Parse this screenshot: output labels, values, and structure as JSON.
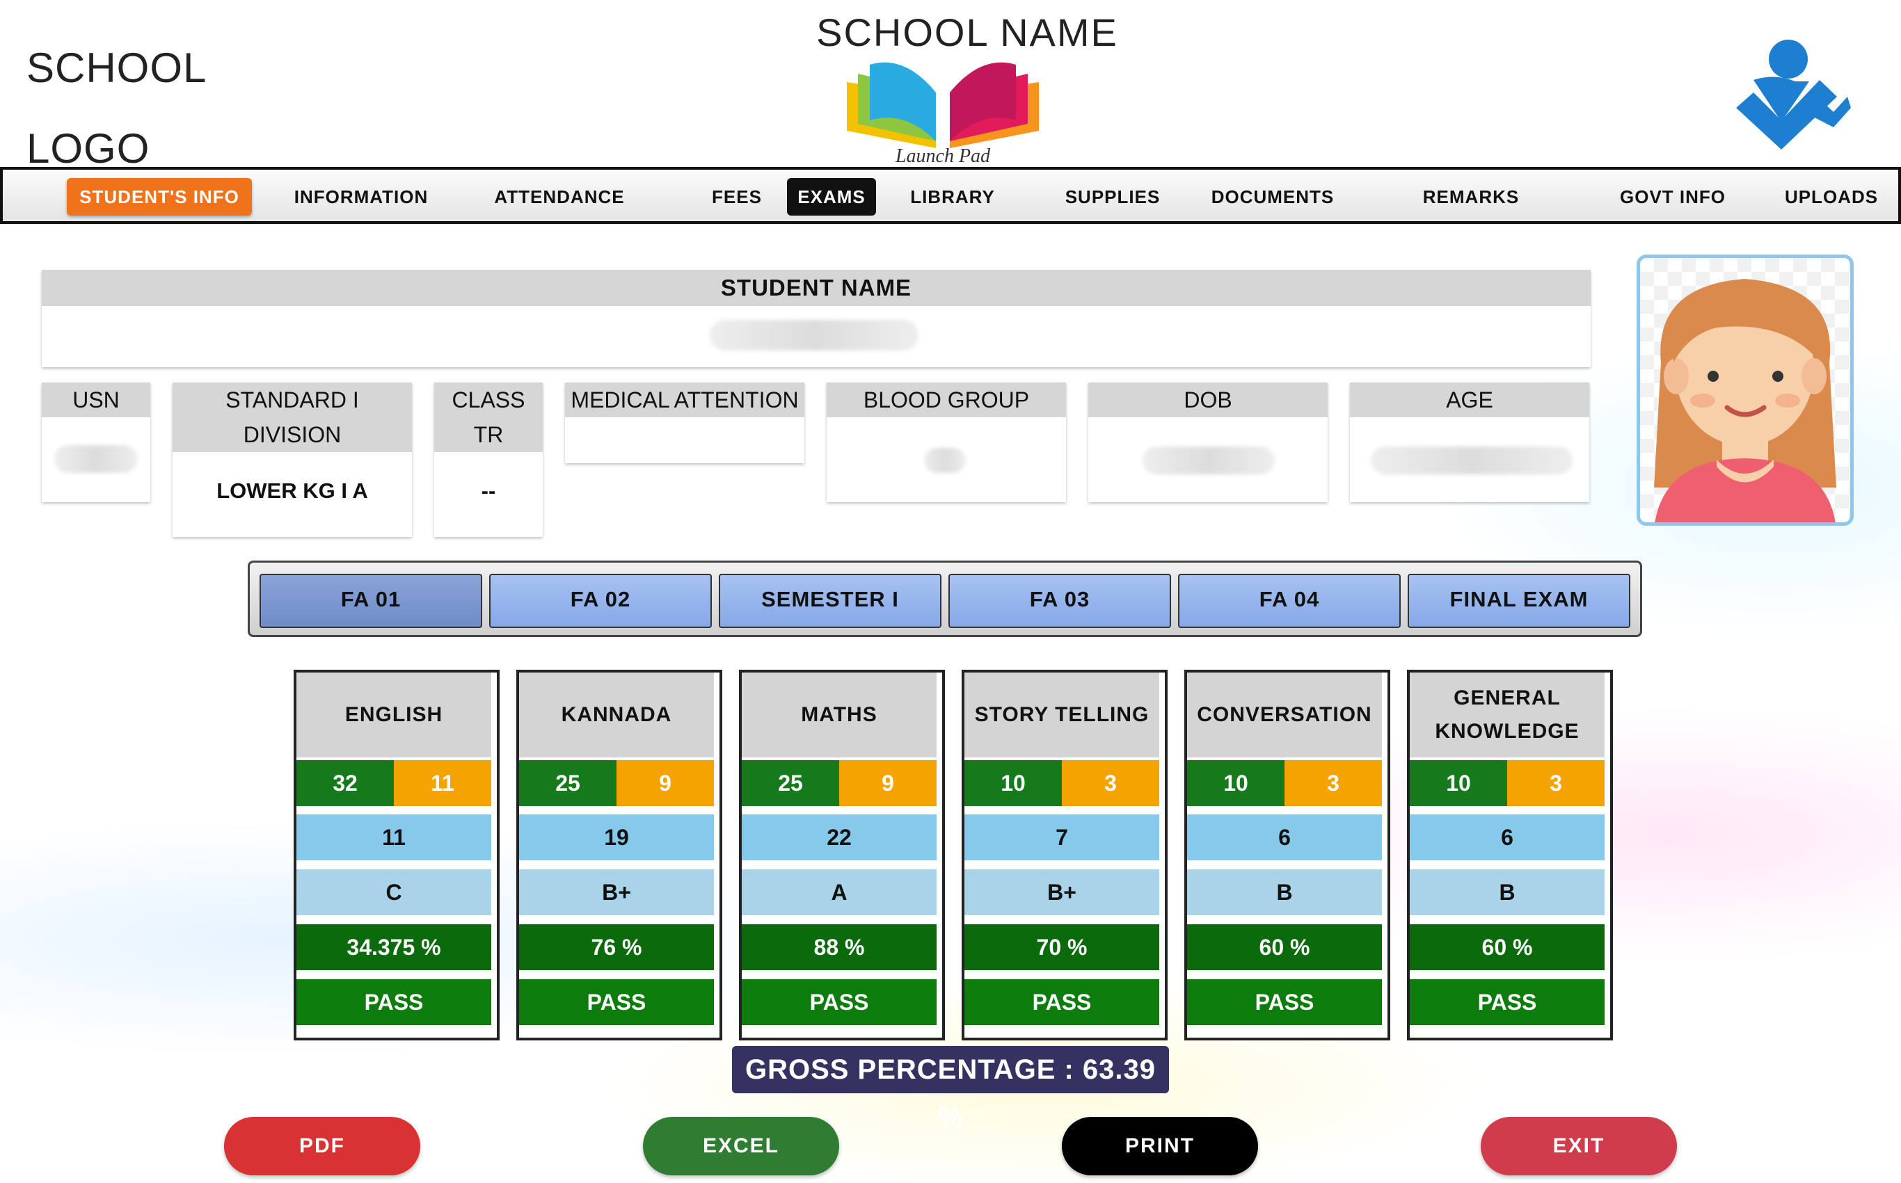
{
  "header": {
    "school_logo_line1": "SCHOOL",
    "school_logo_line2": "LOGO",
    "school_name": "SCHOOL NAME",
    "logo_caption": "Launch Pad",
    "brand_icon": "person-check-icon"
  },
  "nav": {
    "items": [
      "STUDENT'S INFO",
      "INFORMATION",
      "ATTENDANCE",
      "FEES",
      "EXAMS",
      "LIBRARY",
      "SUPPLIES",
      "DOCUMENTS",
      "REMARKS",
      "GOVT INFO",
      "UPLOADS"
    ],
    "active": "STUDENT'S INFO",
    "selected": "EXAMS"
  },
  "student": {
    "name_label": "STUDENT NAME",
    "fields": {
      "usn": {
        "label": "USN"
      },
      "standard": {
        "label_line1": "STANDARD I",
        "label_line2": "DIVISION",
        "value": "LOWER KG I A"
      },
      "class_tr": {
        "label_line1": "CLASS",
        "label_line2": "TR",
        "value": "--"
      },
      "medical": {
        "label": "MEDICAL ATTENTION"
      },
      "blood": {
        "label": "BLOOD GROUP"
      },
      "dob": {
        "label": "DOB"
      },
      "age": {
        "label": "AGE"
      }
    }
  },
  "exam_tabs": [
    "FA 01",
    "FA 02",
    "SEMESTER I",
    "FA 03",
    "FA 04",
    "FINAL EXAM"
  ],
  "selected_exam": "FA 01",
  "subjects": [
    {
      "line1": "ENGLISH",
      "line2": "",
      "a": "32",
      "b": "11",
      "marks": "11",
      "grade": "C",
      "percent": "34.375 %",
      "result": "PASS"
    },
    {
      "line1": "KANNADA",
      "line2": "",
      "a": "25",
      "b": "9",
      "marks": "19",
      "grade": "B+",
      "percent": "76 %",
      "result": "PASS"
    },
    {
      "line1": "MATHS",
      "line2": "",
      "a": "25",
      "b": "9",
      "marks": "22",
      "grade": "A",
      "percent": "88 %",
      "result": "PASS"
    },
    {
      "line1": "STORY TELLING",
      "line2": "",
      "a": "10",
      "b": "3",
      "marks": "7",
      "grade": "B+",
      "percent": "70 %",
      "result": "PASS"
    },
    {
      "line1": "CONVERSATION",
      "line2": "",
      "a": "10",
      "b": "3",
      "marks": "6",
      "grade": "B",
      "percent": "60 %",
      "result": "PASS"
    },
    {
      "line1": "GENERAL",
      "line2": "KNOWLEDGE",
      "a": "10",
      "b": "3",
      "marks": "6",
      "grade": "B",
      "percent": "60 %",
      "result": "PASS"
    }
  ],
  "gross_percentage": "GROSS PERCENTAGE : 63.39 %",
  "buttons": {
    "pdf": "PDF",
    "excel": "EXCEL",
    "print": "PRINT",
    "exit": "EXIT"
  },
  "colors": {
    "nav_active": "#f0731b",
    "max_marks": "#157a1b",
    "min_marks": "#f5a300",
    "gross_bg": "#343261",
    "pdf": "#d83232",
    "excel": "#2e7d32",
    "print": "#000000",
    "exit": "#cf3d4c"
  }
}
